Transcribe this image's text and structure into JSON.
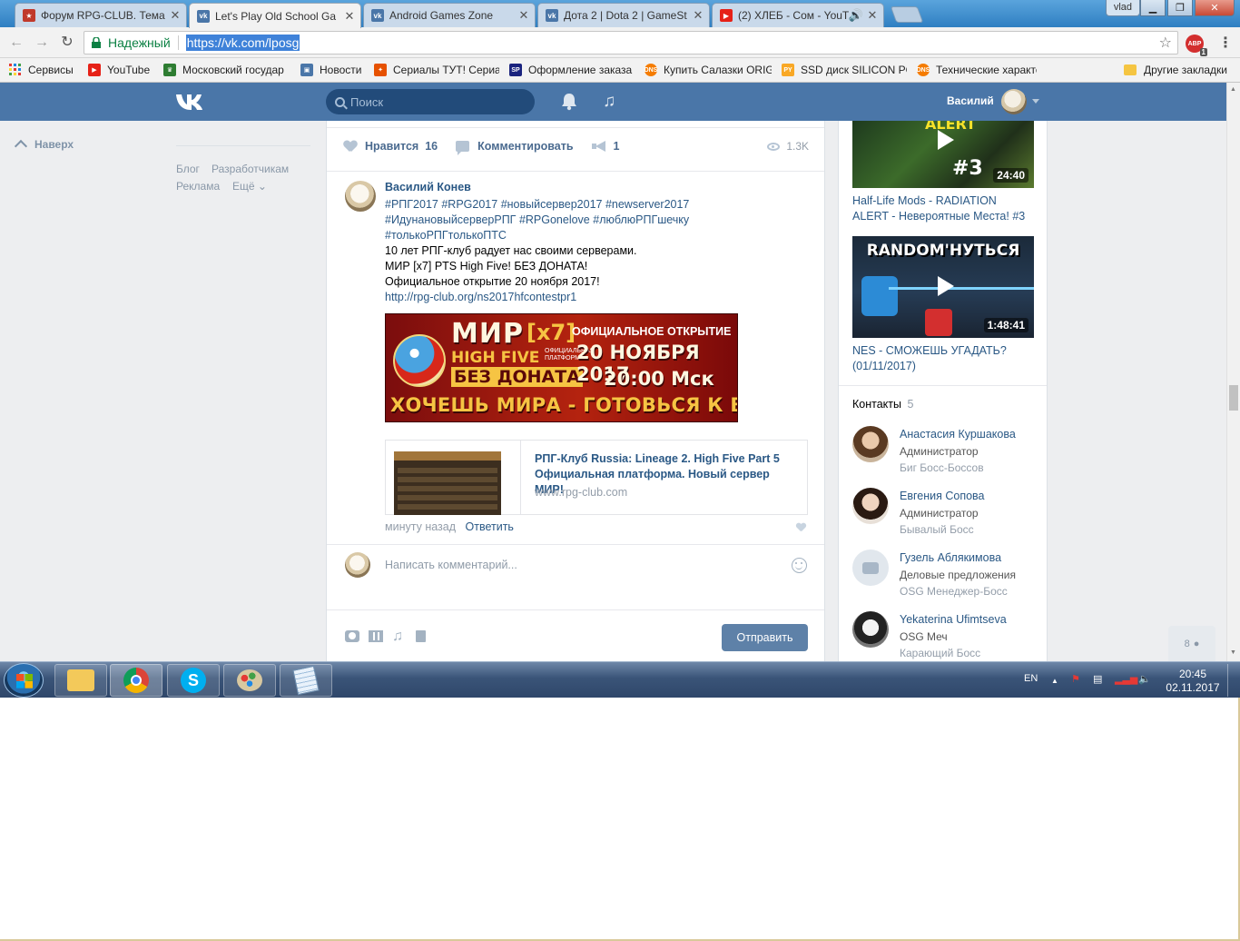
{
  "browser": {
    "tabs": [
      {
        "title": "Форум RPG-CLUB. Тема",
        "icon_color": "#c0392b",
        "icon": "rpg-club-icon"
      },
      {
        "title": "Let's Play Old School Ga",
        "icon_color": "#4a76a8",
        "icon": "vk-icon"
      },
      {
        "title": "Android Games Zone",
        "icon_color": "#4a76a8",
        "icon": "vk-icon"
      },
      {
        "title": "Дота 2 | Dota 2 | GameSt",
        "icon_color": "#4a76a8",
        "icon": "vk-icon"
      },
      {
        "title": "(2) ХЛЕБ - Сом - YouT",
        "icon_color": "#e62117",
        "icon": "youtube-icon"
      }
    ],
    "window_user": "vlad",
    "secure_label": "Надежный",
    "url": "https://vk.com/lposg",
    "extension_badge": "1",
    "extension_label": "ABP",
    "bookmarks": [
      {
        "label": "Сервисы",
        "icon": "apps-grid-icon",
        "color": "#e44"
      },
      {
        "label": "YouTube",
        "icon": "youtube-icon",
        "color": "#e62117"
      },
      {
        "label": "Московский государ",
        "icon": "emblem-icon",
        "color": "#2e7d32"
      },
      {
        "label": "Новости",
        "icon": "news-icon",
        "color": "#4a76a8"
      },
      {
        "label": "Сериалы ТУТ! Сериа",
        "icon": "fire-icon",
        "color": "#e65100"
      },
      {
        "label": "Оформление заказа",
        "icon": "sp-icon",
        "color": "#1a237e"
      },
      {
        "label": "Купить Салазки ORIG",
        "icon": "dns-icon",
        "color": "#f57c00"
      },
      {
        "label": "SSD диск SILICON PC",
        "icon": "py-icon",
        "color": "#f9a825"
      },
      {
        "label": "Технические характе",
        "icon": "dns-icon",
        "color": "#f57c00"
      }
    ],
    "other_bookmarks": "Другие закладки"
  },
  "vk": {
    "search_placeholder": "Поиск",
    "user_name": "Василий",
    "nav_up": "Наверх",
    "footer": {
      "blog": "Блог",
      "dev": "Разработчикам",
      "ads": "Реклама",
      "more": "Ещё"
    },
    "post_actions": {
      "like_label": "Нравится",
      "like_count": "16",
      "comment_label": "Комментировать",
      "share_count": "1",
      "views": "1.3K"
    },
    "comment": {
      "author": "Василий Конев",
      "tags": [
        "#РПГ2017",
        "#RPG2017",
        "#новыйсервер2017",
        "#newserver2017",
        "#ИдунановыйсерверРПГ",
        "#RPGonelove",
        "#люблюРПГшечку",
        "#толькоРПГтолькоПТС"
      ],
      "lines": [
        "10 лет РПГ-клуб радует нас своими серверами.",
        "МИР [x7] PTS High Five! БЕЗ ДОНАТА!",
        "Официальное открытие 20 ноября 2017!"
      ],
      "link": "http://rpg-club.org/ns2017hfcontestpr1",
      "banner": {
        "mir": "МИР",
        "x7": "[x7]",
        "highfive": "HIGH FIVE",
        "platform": "ОФИЦИАЛЬНАЯ ПЛАТФОРМА",
        "no_donate": "БЕЗ ДОНАТА",
        "official": "ОФИЦИАЛЬНОЕ ОТКРЫТИЕ",
        "date": "20 НОЯБРЯ 2017",
        "time": "20:00 Мск",
        "slogan": "ХОЧЕШЬ МИРА - ГОТОВЬСЯ К ВОЙНЕ"
      },
      "snippet": {
        "title": "РПГ-Клуб Russia: Lineage 2. High Five Part 5 Официальная платформа. Новый сервер МИР!",
        "domain": "www.rpg-club.com"
      },
      "time": "минуту назад",
      "reply": "Ответить"
    },
    "comment_placeholder": "Написать комментарий...",
    "send_button": "Отправить",
    "videos": [
      {
        "title": "Half-Life Mods - RADIATION ALERT - Невероятные Места! #3",
        "duration": "24:40",
        "overlay": "ALERT",
        "overlay2": "#3"
      },
      {
        "title": "NES - СМОЖЕШЬ УГАДАТЬ? (01/11/2017)",
        "duration": "1:48:41",
        "overlay": "RANDOM'НУТЬСЯ"
      }
    ],
    "contacts_title": "Контакты",
    "contacts_count": "5",
    "contacts": [
      {
        "name": "Анастасия Куршакова",
        "role": "Администратор",
        "desc": "Биг Босс-Боссов"
      },
      {
        "name": "Евгения Сопова",
        "role": "Администратор",
        "desc": "Бывалый Босс"
      },
      {
        "name": "Гузель Аблякимова",
        "role": "Деловые предложения",
        "desc": "OSG Менеджер-Босс"
      },
      {
        "name": "Yekaterina Ufimtseva",
        "role": "OSG Меч",
        "desc": "Карающий Босс"
      }
    ],
    "friends_count": "8"
  },
  "taskbar": {
    "lang": "EN",
    "time": "20:45",
    "date": "02.11.2017"
  }
}
